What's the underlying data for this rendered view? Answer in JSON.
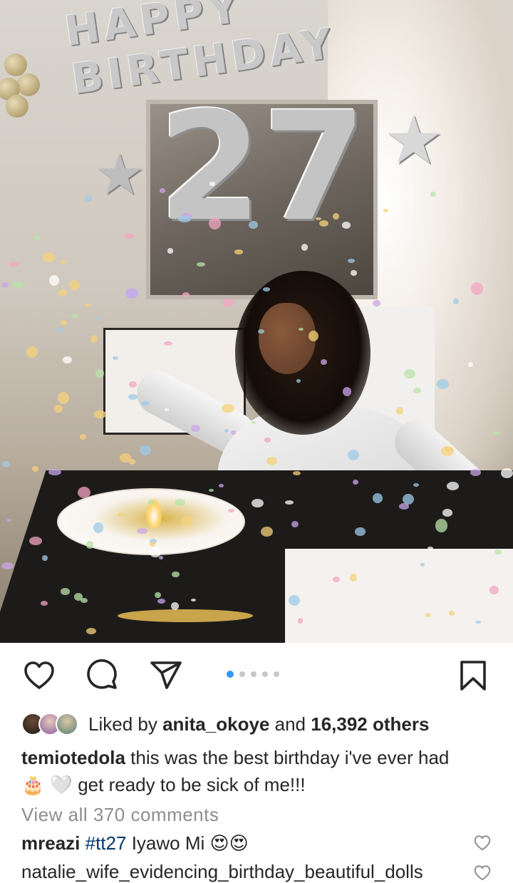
{
  "photo": {
    "banner_text": "HAPPY BIRTHDAY",
    "balloon_number": "27",
    "carousel": {
      "count": 5,
      "active_index": 0
    }
  },
  "actions": {
    "like_icon": "heart-icon",
    "comment_icon": "comment-bubble-icon",
    "share_icon": "paper-plane-icon",
    "save_icon": "bookmark-icon"
  },
  "likes": {
    "prefix": "Liked by",
    "user": "anita_okoye",
    "connector": "and",
    "count_text": "16,392 others"
  },
  "caption": {
    "username": "temiotedola",
    "text": "this was the best birthday i've ever had",
    "emoji_1": "🎂",
    "emoji_2": "🤍",
    "text_2": "get ready to be sick of me!!!"
  },
  "comments_link": "View all 370 comments",
  "comments": [
    {
      "username": "mreazi",
      "hashtag": "#tt27",
      "text": "Iyawo Mi",
      "emoji": "😍😍"
    },
    {
      "text": "natalie_wife_evidencing_birthday_beautiful_dolls"
    }
  ],
  "colors": {
    "accent": "#3897f0",
    "muted": "#8e8e8e",
    "text": "#262626",
    "link": "#00376b"
  }
}
